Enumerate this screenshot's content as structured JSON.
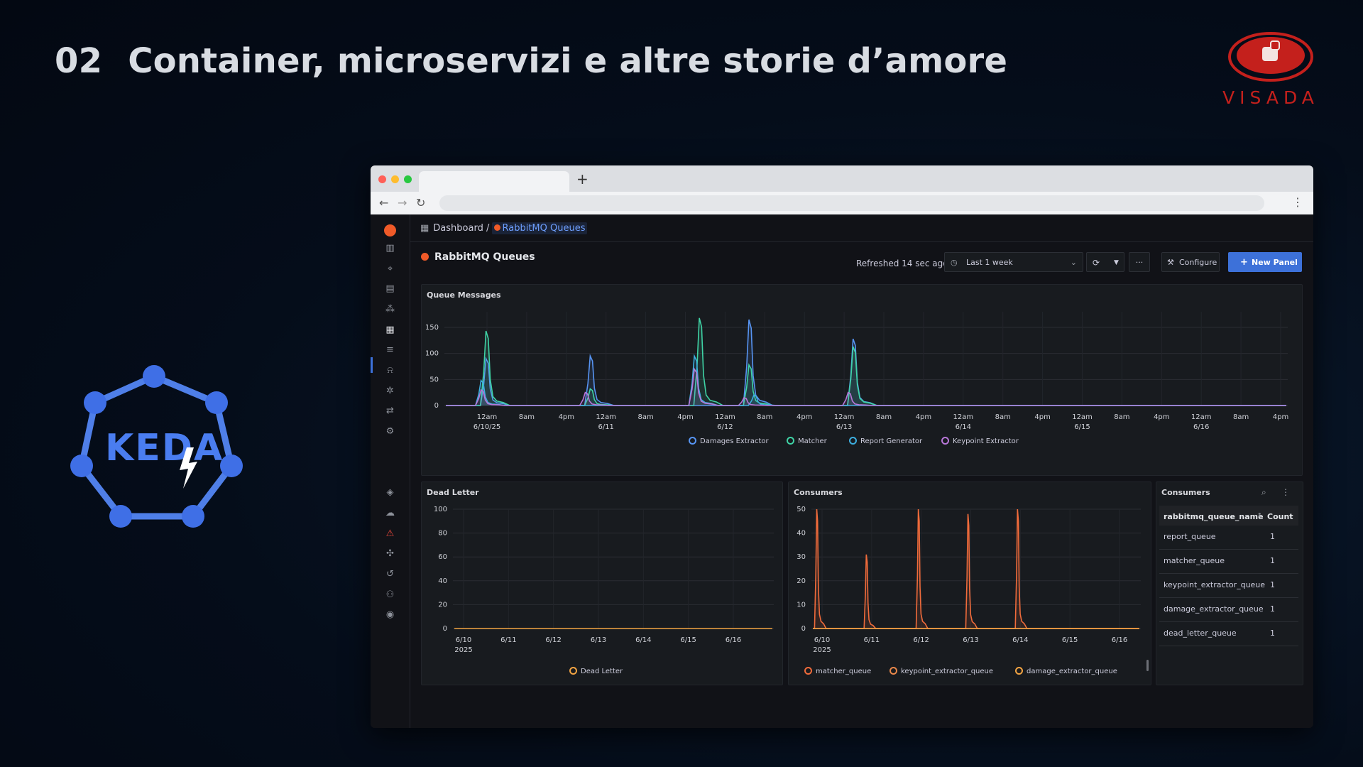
{
  "slide": {
    "number": "02",
    "title": "Container, microservizi e altre storie d’amore",
    "brand": "VISADA",
    "keda_logo": "KEDA"
  },
  "browser": {
    "new_tab": "+"
  },
  "grafana": {
    "breadcrumb_root": "Dashboard /",
    "breadcrumb_current": "RabbitMQ Queues",
    "dashboard_title": "RabbitMQ Queues",
    "refreshed": "Refreshed 14 sec ago",
    "time_range": "Last 1 week",
    "more": "···",
    "configure": "Configure",
    "new_panel": "New Panel",
    "sidebar_icons": [
      "bar-chart-icon",
      "compass-icon",
      "document-icon",
      "apps-icon",
      "dashboards-icon",
      "list-icon",
      "bell-icon",
      "bug-icon",
      "flow-icon",
      "gear-icon",
      "layers-icon",
      "cloud-icon",
      "alert-icon",
      "plugin-icon",
      "history-icon",
      "user-add-icon",
      "profile-icon"
    ]
  },
  "colors": {
    "accent": "#3d71d9",
    "grafana_orange": "#f05a28"
  },
  "chart_data": [
    {
      "type": "line",
      "title": "Queue Messages",
      "ylim": [
        0,
        180
      ],
      "y_ticks": [
        0,
        50,
        100,
        150
      ],
      "x_ticks": [
        {
          "l1": "12am",
          "l2": "6/10/25"
        },
        {
          "l1": "8am",
          "l2": ""
        },
        {
          "l1": "4pm",
          "l2": ""
        },
        {
          "l1": "12am",
          "l2": "6/11"
        },
        {
          "l1": "8am",
          "l2": ""
        },
        {
          "l1": "4pm",
          "l2": ""
        },
        {
          "l1": "12am",
          "l2": "6/12"
        },
        {
          "l1": "8am",
          "l2": ""
        },
        {
          "l1": "4pm",
          "l2": ""
        },
        {
          "l1": "12am",
          "l2": "6/13"
        },
        {
          "l1": "8am",
          "l2": ""
        },
        {
          "l1": "4pm",
          "l2": ""
        },
        {
          "l1": "12am",
          "l2": "6/14"
        },
        {
          "l1": "8am",
          "l2": ""
        },
        {
          "l1": "4pm",
          "l2": ""
        },
        {
          "l1": "12am",
          "l2": "6/15"
        },
        {
          "l1": "8am",
          "l2": ""
        },
        {
          "l1": "4pm",
          "l2": ""
        },
        {
          "l1": "12am",
          "l2": "6/16"
        },
        {
          "l1": "8am",
          "l2": ""
        },
        {
          "l1": "4pm",
          "l2": ""
        }
      ],
      "x_range_hours": [
        -3,
        161
      ],
      "series": [
        {
          "name": "Damages Extractor",
          "color": "#5794f2",
          "peaks": [
            [
              0,
              90
            ],
            [
              21,
              95
            ],
            [
              53,
              165
            ],
            [
              74,
              128
            ]
          ]
        },
        {
          "name": "Matcher",
          "color": "#3fd3a5",
          "peaks": [
            [
              0,
              143
            ],
            [
              21,
              32
            ],
            [
              43,
              168
            ],
            [
              53,
              78
            ],
            [
              74,
              113
            ]
          ]
        },
        {
          "name": "Report Generator",
          "color": "#3dafe0",
          "peaks": [
            [
              -1,
              48
            ],
            [
              42,
              95
            ],
            [
              54,
              20
            ]
          ]
        },
        {
          "name": "Keypoint Extractor",
          "color": "#b877d9",
          "peaks": [
            [
              -1,
              30
            ],
            [
              20,
              25
            ],
            [
              42,
              70
            ],
            [
              52,
              15
            ],
            [
              73,
              25
            ]
          ]
        }
      ]
    },
    {
      "type": "line",
      "title": "Dead Letter",
      "ylim": [
        0,
        100
      ],
      "y_ticks": [
        0,
        20,
        40,
        60,
        80,
        100
      ],
      "x_ticks": [
        {
          "l1": "6/10",
          "l2": "2025"
        },
        {
          "l1": "6/11",
          "l2": ""
        },
        {
          "l1": "6/12",
          "l2": ""
        },
        {
          "l1": "6/13",
          "l2": ""
        },
        {
          "l1": "6/14",
          "l2": ""
        },
        {
          "l1": "6/15",
          "l2": ""
        },
        {
          "l1": "6/16",
          "l2": ""
        }
      ],
      "series": [
        {
          "name": "Dead Letter",
          "color": "#f2a443",
          "values": [
            0,
            0,
            0,
            0,
            0,
            0,
            0
          ]
        }
      ]
    },
    {
      "type": "line",
      "title": "Consumers",
      "ylim": [
        0,
        50
      ],
      "y_ticks": [
        0,
        10,
        20,
        30,
        40,
        50
      ],
      "x_ticks": [
        {
          "l1": "6/10",
          "l2": "2025"
        },
        {
          "l1": "6/11",
          "l2": ""
        },
        {
          "l1": "6/12",
          "l2": ""
        },
        {
          "l1": "6/13",
          "l2": ""
        },
        {
          "l1": "6/14",
          "l2": ""
        },
        {
          "l1": "6/15",
          "l2": ""
        },
        {
          "l1": "6/16",
          "l2": ""
        }
      ],
      "series": [
        {
          "name": "matcher_queue",
          "color": "#f06b3b",
          "peaks": [
            [
              -0.1,
              50
            ],
            [
              0.9,
              31
            ],
            [
              1.95,
              50
            ],
            [
              2.95,
              48
            ],
            [
              3.95,
              50
            ]
          ]
        },
        {
          "name": "keypoint_extractor_queue",
          "color": "#e8874a",
          "peaks": [
            [
              0,
              0
            ]
          ]
        },
        {
          "name": "damage_extractor_queue",
          "color": "#f2a443",
          "peaks": [
            [
              0,
              0
            ]
          ]
        }
      ]
    }
  ],
  "consumers_table": {
    "title": "Consumers",
    "columns": [
      "rabbitmq_queue_name",
      "Count"
    ],
    "rows": [
      [
        "report_queue",
        "1"
      ],
      [
        "matcher_queue",
        "1"
      ],
      [
        "keypoint_extractor_queue",
        "1"
      ],
      [
        "damage_extractor_queue",
        "1"
      ],
      [
        "dead_letter_queue",
        "1"
      ]
    ]
  }
}
